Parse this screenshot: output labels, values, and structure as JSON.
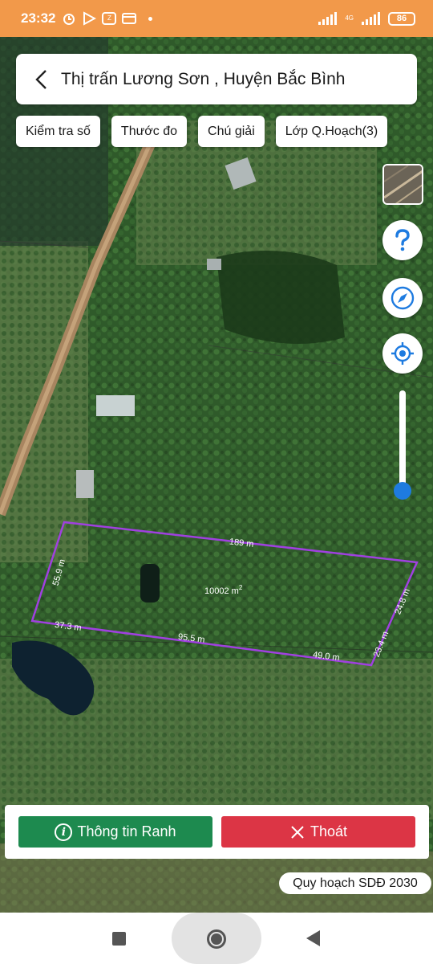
{
  "status_bar": {
    "time": "23:32",
    "network": "4G",
    "battery": "86",
    "icons": [
      "alarm-icon",
      "play-icon",
      "zalo-icon",
      "card-icon",
      "dot-icon",
      "signal-icon",
      "signal-icon",
      "battery-icon"
    ]
  },
  "header": {
    "back_icon": "chevron-left-icon",
    "title": "Thị trấn Lương Sơn , Huyện Bắc Bình"
  },
  "toolbar": {
    "chips": [
      "Kiểm tra số",
      "Thước đo",
      "Chú giải",
      "Lớp Q.Hoạch(3)"
    ]
  },
  "map_controls": {
    "icons": [
      "layer-thumbnail",
      "help-icon",
      "compass-icon",
      "locate-icon"
    ],
    "accent_color": "#1e7be0",
    "zoom_level": 0.05
  },
  "parcel": {
    "area": "10002 m",
    "area_sup": "2",
    "outline_color": "#a040e0",
    "edges": [
      "189 m",
      "55.9 m",
      "37.3 m",
      "95.5 m",
      "49.0 m",
      "23.4 m",
      "24.8 m"
    ]
  },
  "bottom_actions": {
    "info_label": "Thông tin Ranh",
    "exit_label": "Thoát",
    "info_color": "#1d8a4f",
    "exit_color": "#dc3545"
  },
  "plan_badge": "Quy hoạch SDĐ 2030",
  "nav_bar": {
    "icons": [
      "recent-apps-icon",
      "home-icon",
      "back-icon"
    ]
  }
}
